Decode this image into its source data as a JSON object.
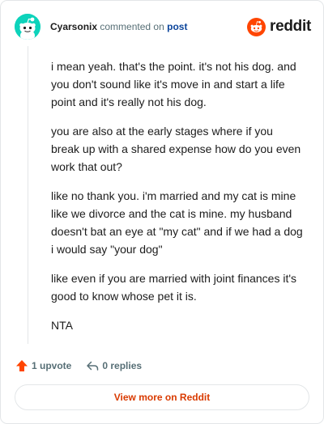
{
  "header": {
    "username": "Cyarsonix",
    "action_text": "commented on",
    "post_link": "post",
    "brand": "reddit",
    "avatar_icon": "snoo-avatar-icon",
    "brand_icon": "reddit-logo-icon"
  },
  "comment": {
    "paragraphs": [
      "i mean yeah. that's the point. it's not his dog. and you don't sound like it's move in and start a life point and it's really not his dog.",
      "you are also at the early stages where if you break up with a shared expense how do you even work that out?",
      "like no thank you. i'm married and my cat is mine like we divorce and the cat is mine. my husband doesn't bat an eye at \"my cat\" and if we had a dog i would say \"your dog\"",
      "like even if you are married with joint finances it's good to know whose pet it is.",
      "NTA"
    ]
  },
  "actions": {
    "upvote_label": "1 upvote",
    "replies_label": "0 replies",
    "upvote_icon": "upvote-arrow-icon",
    "reply_icon": "reply-arrow-icon"
  },
  "footer": {
    "view_more_label": "View more on Reddit"
  },
  "colors": {
    "accent": "#d93a00",
    "upvote": "#ff4500",
    "avatar_bg": "#0dd3bb",
    "link": "#0a449b",
    "muted": "#576f76",
    "border": "#e3e6e8"
  }
}
